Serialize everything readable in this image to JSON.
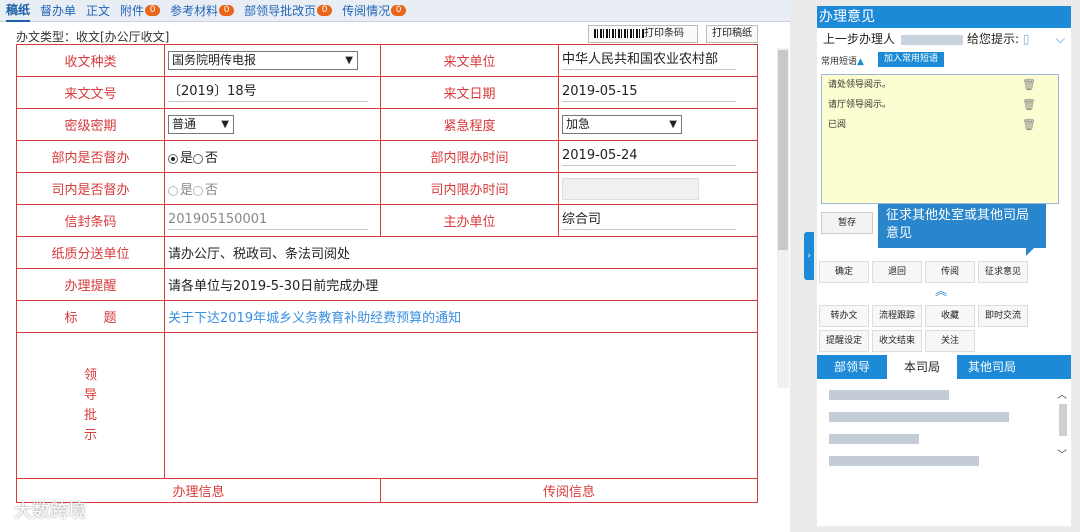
{
  "tabs": [
    {
      "label": "稿纸",
      "badge": null,
      "active": true
    },
    {
      "label": "督办单",
      "badge": null
    },
    {
      "label": "正文",
      "badge": null
    },
    {
      "label": "附件",
      "badge": "0"
    },
    {
      "label": "参考材料",
      "badge": "0"
    },
    {
      "label": "部领导批改页",
      "badge": "0"
    },
    {
      "label": "传阅情况",
      "badge": "0"
    }
  ],
  "form": {
    "doc_type": "办文类型：收文[办公厅收文]",
    "print_barcode": "打印条码",
    "print_manuscript": "打印稿纸",
    "rows": {
      "recv_type_label": "收文种类",
      "recv_type_value": "国务院明传电报",
      "from_unit_label": "来文单位",
      "from_unit_value": "中华人民共和国农业农村部",
      "doc_no_label": "来文文号",
      "doc_no_value": "〔2019〕18号",
      "doc_date_label": "来文日期",
      "doc_date_value": "2019-05-15",
      "secret_label": "密级密期",
      "secret_value": "普通",
      "urgency_label": "紧急程度",
      "urgency_value": "加急",
      "dept_sup_label": "部内是否督办",
      "yes": "是",
      "no": "否",
      "dept_limit_label": "部内限办时间",
      "dept_limit_value": "2019-05-24",
      "bureau_sup_label": "司内是否督办",
      "bureau_limit_label": "司内限办时间",
      "barcode_label": "信封条码",
      "barcode_value": "201905150001",
      "main_unit_label": "主办单位",
      "main_unit_value": "综合司",
      "paper_label": "纸质分送单位",
      "paper_value": "请办公厅、税政司、条法司阅处",
      "remind_label": "办理提醒",
      "remind_value": "请各单位与2019-5-30日前完成办理",
      "title_label": "标　　题",
      "title_value": "关于下达2019年城乡义务教育补助经费预算的通知",
      "leader_label": "领\n导\n批\n示",
      "process_info": "办理信息",
      "circulate_info": "传阅信息"
    }
  },
  "watermark": "大数跨境",
  "right": {
    "title": "办理意见",
    "prev_handler": "上一步办理人",
    "prompt": "给您提示:",
    "common_phrase": "常用短语",
    "add_phrase": "加入常用短语",
    "phrases": [
      "请处领导阅示。",
      "请厅领导阅示。",
      "已阅"
    ],
    "temp_save": "暂存",
    "tooltip": "征求其他处室或其他司局意见",
    "row1": [
      "确定",
      "退回",
      "传阅",
      "征求意见"
    ],
    "row2": [
      "转办文",
      "流程跟踪",
      "收藏",
      "即时交流"
    ],
    "row3": [
      "提醒设定",
      "收文结束",
      "关注"
    ],
    "lower_tabs": [
      "部领导",
      "本司局",
      "其他司局"
    ]
  },
  "colors": {
    "accent": "#1c8ad6",
    "border_red": "#d83a3a",
    "badge": "#e8651a",
    "link": "#3a8ee0"
  }
}
